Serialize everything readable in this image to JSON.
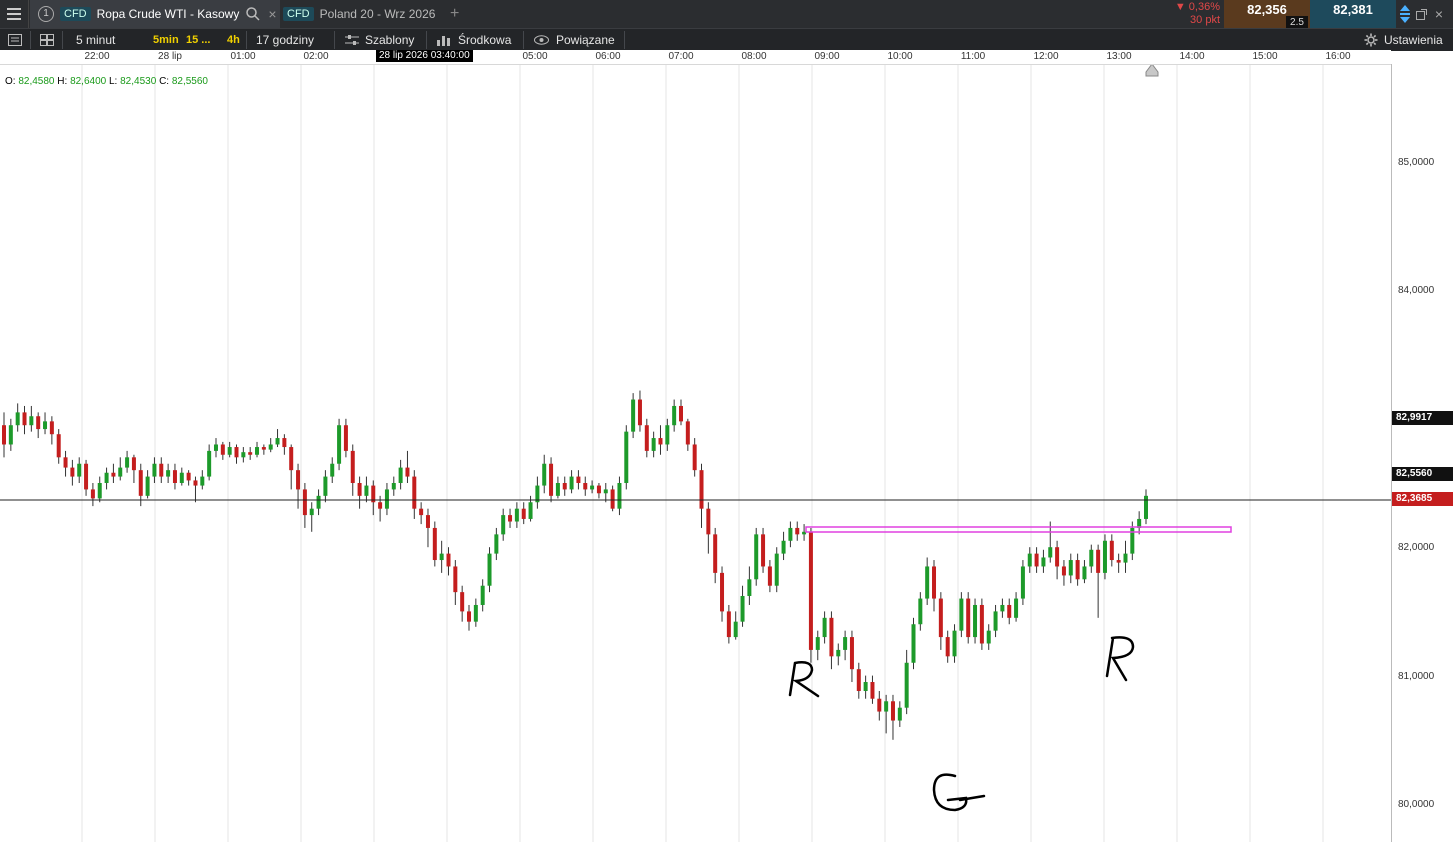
{
  "topbar": {
    "tabs": [
      {
        "number": "1",
        "badge": "CFD",
        "title": "Ropa Crude WTI - Kasowy"
      },
      {
        "badge": "CFD",
        "title": "Poland 20 - Wrz 2026"
      }
    ],
    "change_pct": "▼ 0,36%",
    "change_pts": "30 pkt",
    "sell_price": "82,356",
    "spread": "2.5",
    "buy_price": "82,381"
  },
  "toolbar": {
    "interval": "5 minut",
    "quick_5min": "5min",
    "quick_15": "15 ...",
    "quick_4h": "4h",
    "range": "17 godziny",
    "templates": "Szablony",
    "indicator": "Środkowa",
    "linked": "Powiązane",
    "settings": "Ustawienia"
  },
  "ohlc": {
    "o": "82,4580",
    "h": "82,6400",
    "l": "82,4530",
    "c": "82,5560"
  },
  "cursor_time": "28 lip 2026 03:40:00",
  "time_axis": [
    "22:00",
    "28 lip",
    "01:00",
    "02:00",
    "05:00",
    "06:00",
    "07:00",
    "08:00",
    "09:00",
    "10:00",
    "11:00",
    "12:00",
    "13:00",
    "14:00",
    "15:00",
    "16:00"
  ],
  "price_axis": [
    "85,0000",
    "84,0000",
    "82,0000",
    "81,0000",
    "80,0000"
  ],
  "price_tags": {
    "high": "82,9917",
    "close": "82,5560",
    "current": "82,3685"
  },
  "annotations": [
    "R",
    "G",
    "R"
  ],
  "colors": {
    "up": "#1d9a2a",
    "down": "#c41e1e",
    "resistance": "#e040e0"
  },
  "chart_data": {
    "type": "candlestick",
    "x_axis": "time (5 minute candles)",
    "ylim": [
      79.9,
      85.6
    ],
    "resistance_level": 82.14,
    "current_price": 82.3685,
    "candles": [
      [
        82.95,
        82.8,
        83.05,
        82.7
      ],
      [
        82.8,
        82.95,
        83.0,
        82.75
      ],
      [
        82.95,
        83.05,
        83.12,
        82.9
      ],
      [
        83.05,
        82.95,
        83.1,
        82.88
      ],
      [
        82.95,
        83.02,
        83.1,
        82.9
      ],
      [
        83.02,
        82.92,
        83.05,
        82.85
      ],
      [
        82.92,
        82.98,
        83.05,
        82.88
      ],
      [
        82.98,
        82.88,
        83.02,
        82.8
      ],
      [
        82.88,
        82.7,
        82.92,
        82.65
      ],
      [
        82.7,
        82.62,
        82.75,
        82.55
      ],
      [
        82.62,
        82.55,
        82.68,
        82.48
      ],
      [
        82.55,
        82.65,
        82.7,
        82.5
      ],
      [
        82.65,
        82.45,
        82.68,
        82.4
      ],
      [
        82.45,
        82.38,
        82.5,
        82.32
      ],
      [
        82.38,
        82.5,
        82.55,
        82.35
      ],
      [
        82.5,
        82.58,
        82.62,
        82.45
      ],
      [
        82.58,
        82.55,
        82.65,
        82.5
      ],
      [
        82.55,
        82.62,
        82.7,
        82.52
      ],
      [
        82.62,
        82.7,
        82.75,
        82.58
      ],
      [
        82.7,
        82.6,
        82.72,
        82.5
      ],
      [
        82.6,
        82.4,
        82.65,
        82.32
      ],
      [
        82.4,
        82.55,
        82.6,
        82.38
      ],
      [
        82.55,
        82.65,
        82.7,
        82.5
      ],
      [
        82.65,
        82.55,
        82.7,
        82.5
      ],
      [
        82.55,
        82.6,
        82.65,
        82.5
      ],
      [
        82.6,
        82.5,
        82.65,
        82.45
      ],
      [
        82.5,
        82.58,
        82.62,
        82.48
      ],
      [
        82.58,
        82.52,
        82.6,
        82.48
      ],
      [
        82.52,
        82.48,
        82.55,
        82.35
      ],
      [
        82.48,
        82.55,
        82.6,
        82.45
      ],
      [
        82.55,
        82.75,
        82.8,
        82.52
      ],
      [
        82.75,
        82.8,
        82.85,
        82.7
      ],
      [
        82.8,
        82.72,
        82.82,
        82.68
      ],
      [
        82.72,
        82.78,
        82.82,
        82.7
      ],
      [
        82.78,
        82.7,
        82.8,
        82.65
      ],
      [
        82.7,
        82.74,
        82.78,
        82.66
      ],
      [
        82.74,
        82.72,
        82.78,
        82.68
      ],
      [
        82.72,
        82.78,
        82.82,
        82.7
      ],
      [
        82.78,
        82.76,
        82.8,
        82.72
      ],
      [
        82.76,
        82.8,
        82.85,
        82.74
      ],
      [
        82.8,
        82.85,
        82.92,
        82.78
      ],
      [
        82.85,
        82.78,
        82.88,
        82.72
      ],
      [
        82.78,
        82.6,
        82.8,
        82.45
      ],
      [
        82.6,
        82.45,
        82.65,
        82.3
      ],
      [
        82.45,
        82.25,
        82.5,
        82.15
      ],
      [
        82.25,
        82.3,
        82.35,
        82.12
      ],
      [
        82.3,
        82.4,
        82.45,
        82.25
      ],
      [
        82.4,
        82.55,
        82.6,
        82.35
      ],
      [
        82.55,
        82.65,
        82.7,
        82.5
      ],
      [
        82.65,
        82.95,
        83.0,
        82.6
      ],
      [
        82.95,
        82.75,
        83.0,
        82.7
      ],
      [
        82.75,
        82.5,
        82.8,
        82.4
      ],
      [
        82.5,
        82.4,
        82.55,
        82.3
      ],
      [
        82.4,
        82.48,
        82.55,
        82.35
      ],
      [
        82.48,
        82.35,
        82.52,
        82.25
      ],
      [
        82.35,
        82.3,
        82.4,
        82.2
      ],
      [
        82.3,
        82.45,
        82.5,
        82.25
      ],
      [
        82.45,
        82.5,
        82.55,
        82.4
      ],
      [
        82.5,
        82.62,
        82.68,
        82.45
      ],
      [
        82.62,
        82.55,
        82.75,
        82.5
      ],
      [
        82.55,
        82.3,
        82.6,
        82.22
      ],
      [
        82.3,
        82.25,
        82.35,
        82.18
      ],
      [
        82.25,
        82.15,
        82.3,
        82.0
      ],
      [
        82.15,
        81.9,
        82.2,
        81.85
      ],
      [
        81.9,
        81.95,
        82.05,
        81.8
      ],
      [
        81.95,
        81.85,
        82.0,
        81.78
      ],
      [
        81.85,
        81.65,
        81.9,
        81.55
      ],
      [
        81.65,
        81.5,
        81.7,
        81.42
      ],
      [
        81.5,
        81.42,
        81.55,
        81.35
      ],
      [
        81.42,
        81.55,
        81.6,
        81.38
      ],
      [
        81.55,
        81.7,
        81.75,
        81.5
      ],
      [
        81.7,
        81.95,
        82.0,
        81.65
      ],
      [
        81.95,
        82.1,
        82.15,
        81.9
      ],
      [
        82.1,
        82.25,
        82.3,
        82.05
      ],
      [
        82.25,
        82.2,
        82.3,
        82.15
      ],
      [
        82.2,
        82.3,
        82.35,
        82.15
      ],
      [
        82.3,
        82.22,
        82.35,
        82.18
      ],
      [
        82.22,
        82.35,
        82.4,
        82.2
      ],
      [
        82.35,
        82.48,
        82.55,
        82.3
      ],
      [
        82.48,
        82.65,
        82.72,
        82.42
      ],
      [
        82.65,
        82.4,
        82.7,
        82.35
      ],
      [
        82.4,
        82.5,
        82.55,
        82.38
      ],
      [
        82.5,
        82.45,
        82.55,
        82.4
      ],
      [
        82.45,
        82.55,
        82.6,
        82.42
      ],
      [
        82.55,
        82.5,
        82.6,
        82.45
      ],
      [
        82.5,
        82.45,
        82.55,
        82.4
      ],
      [
        82.45,
        82.48,
        82.52,
        82.42
      ],
      [
        82.48,
        82.42,
        82.5,
        82.38
      ],
      [
        82.42,
        82.45,
        82.5,
        82.35
      ],
      [
        82.45,
        82.3,
        82.48,
        82.28
      ],
      [
        82.3,
        82.5,
        82.55,
        82.25
      ],
      [
        82.5,
        82.9,
        82.95,
        82.45
      ],
      [
        82.9,
        83.15,
        83.2,
        82.85
      ],
      [
        83.15,
        82.95,
        83.22,
        82.9
      ],
      [
        82.95,
        82.75,
        83.0,
        82.7
      ],
      [
        82.75,
        82.85,
        82.9,
        82.7
      ],
      [
        82.85,
        82.8,
        82.95,
        82.72
      ],
      [
        82.8,
        82.95,
        83.0,
        82.75
      ],
      [
        82.95,
        83.1,
        83.15,
        82.9
      ],
      [
        83.1,
        82.98,
        83.15,
        82.95
      ],
      [
        82.98,
        82.8,
        83.0,
        82.75
      ],
      [
        82.8,
        82.6,
        82.85,
        82.55
      ],
      [
        82.6,
        82.3,
        82.65,
        82.15
      ],
      [
        82.3,
        82.1,
        82.35,
        81.95
      ],
      [
        82.1,
        81.8,
        82.15,
        81.72
      ],
      [
        81.8,
        81.5,
        81.85,
        81.42
      ],
      [
        81.5,
        81.3,
        81.55,
        81.25
      ],
      [
        81.3,
        81.42,
        81.5,
        81.28
      ],
      [
        81.42,
        81.62,
        81.7,
        81.38
      ],
      [
        81.62,
        81.75,
        81.85,
        81.55
      ],
      [
        81.75,
        82.1,
        82.15,
        81.7
      ],
      [
        82.1,
        81.85,
        82.15,
        81.8
      ],
      [
        81.85,
        81.7,
        81.9,
        81.65
      ],
      [
        81.7,
        81.95,
        82.0,
        81.65
      ],
      [
        81.95,
        82.05,
        82.12,
        81.9
      ],
      [
        82.05,
        82.15,
        82.2,
        82.0
      ],
      [
        82.15,
        82.1,
        82.2,
        82.05
      ],
      [
        82.1,
        82.12,
        82.18,
        82.05
      ],
      [
        82.12,
        81.2,
        82.15,
        81.1
      ],
      [
        81.2,
        81.3,
        81.35,
        81.12
      ],
      [
        81.3,
        81.45,
        81.5,
        81.25
      ],
      [
        81.45,
        81.15,
        81.5,
        81.05
      ],
      [
        81.15,
        81.2,
        81.25,
        81.08
      ],
      [
        81.2,
        81.3,
        81.35,
        81.12
      ],
      [
        81.3,
        81.05,
        81.35,
        80.95
      ],
      [
        81.05,
        80.88,
        81.1,
        80.82
      ],
      [
        80.88,
        80.95,
        81.0,
        80.82
      ],
      [
        80.95,
        80.82,
        81.0,
        80.78
      ],
      [
        80.82,
        80.72,
        80.88,
        80.65
      ],
      [
        80.72,
        80.8,
        80.85,
        80.55
      ],
      [
        80.8,
        80.65,
        80.85,
        80.5
      ],
      [
        80.65,
        80.75,
        80.8,
        80.6
      ],
      [
        80.75,
        81.1,
        81.2,
        80.7
      ],
      [
        81.1,
        81.4,
        81.45,
        81.05
      ],
      [
        81.4,
        81.6,
        81.65,
        81.35
      ],
      [
        81.6,
        81.85,
        81.92,
        81.55
      ],
      [
        81.85,
        81.6,
        81.9,
        81.5
      ],
      [
        81.6,
        81.3,
        81.65,
        81.2
      ],
      [
        81.3,
        81.15,
        81.35,
        81.1
      ],
      [
        81.15,
        81.35,
        81.4,
        81.1
      ],
      [
        81.35,
        81.6,
        81.65,
        81.3
      ],
      [
        81.6,
        81.3,
        81.65,
        81.25
      ],
      [
        81.3,
        81.55,
        81.6,
        81.25
      ],
      [
        81.55,
        81.25,
        81.6,
        81.2
      ],
      [
        81.25,
        81.35,
        81.4,
        81.2
      ],
      [
        81.35,
        81.5,
        81.55,
        81.3
      ],
      [
        81.5,
        81.55,
        81.6,
        81.45
      ],
      [
        81.55,
        81.45,
        81.6,
        81.4
      ],
      [
        81.45,
        81.6,
        81.65,
        81.42
      ],
      [
        81.6,
        81.85,
        81.9,
        81.55
      ],
      [
        81.85,
        81.95,
        82.0,
        81.8
      ],
      [
        81.95,
        81.85,
        82.0,
        81.8
      ],
      [
        81.85,
        81.92,
        81.98,
        81.8
      ],
      [
        81.92,
        82.0,
        82.2,
        81.88
      ],
      [
        82.0,
        81.85,
        82.05,
        81.75
      ],
      [
        81.85,
        81.78,
        81.9,
        81.7
      ],
      [
        81.78,
        81.9,
        81.95,
        81.72
      ],
      [
        81.9,
        81.75,
        81.95,
        81.7
      ],
      [
        81.75,
        81.85,
        81.9,
        81.72
      ],
      [
        81.85,
        81.98,
        82.02,
        81.8
      ],
      [
        81.98,
        81.8,
        82.02,
        81.45
      ],
      [
        81.8,
        82.05,
        82.1,
        81.75
      ],
      [
        82.05,
        81.9,
        82.1,
        81.85
      ],
      [
        81.9,
        81.88,
        81.95,
        81.8
      ],
      [
        81.88,
        81.95,
        82.05,
        81.8
      ],
      [
        81.95,
        82.15,
        82.2,
        81.9
      ],
      [
        82.15,
        82.22,
        82.28,
        82.1
      ],
      [
        82.22,
        82.4,
        82.45,
        82.18
      ]
    ]
  }
}
